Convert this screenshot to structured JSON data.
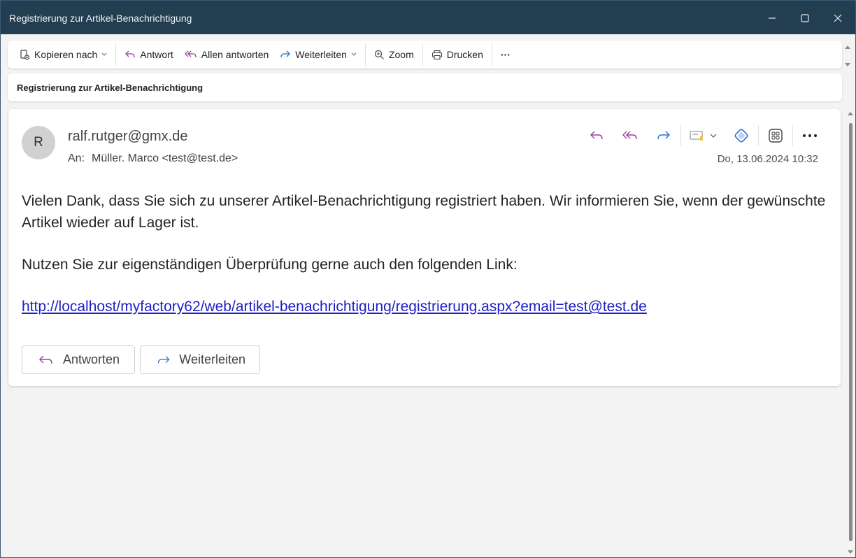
{
  "window": {
    "title": "Registrierung zur Artikel-Benachrichtigung"
  },
  "toolbar": {
    "copy_to": "Kopieren nach",
    "reply": "Antwort",
    "reply_all": "Allen antworten",
    "forward": "Weiterleiten",
    "zoom": "Zoom",
    "print": "Drucken",
    "more": "···"
  },
  "subject": "Registrierung zur Artikel-Benachrichtigung",
  "message": {
    "avatar_initial": "R",
    "sender": "ralf.rutger@gmx.de",
    "to_label": "An:",
    "to_value": "Müller. Marco <test@test.de>",
    "date": "Do, 13.06.2024 10:32",
    "body_p1": "Vielen Dank, dass Sie sich zu unserer Artikel-Benachrichtigung registriert haben. Wir informieren Sie, wenn der gewünschte Artikel wieder auf Lager ist.",
    "body_p2": "Nutzen Sie zur eigenständigen Überprüfung gerne auch den folgenden Link:",
    "link": "http://localhost/myfactory62/web/artikel-benachrichtigung/registrierung.aspx?email=test@test.de"
  },
  "reply_buttons": {
    "reply": "Antworten",
    "forward": "Weiterleiten"
  },
  "colors": {
    "titlebar": "#233d51",
    "reply_icon": "#9b3ea4",
    "forward_icon": "#2a6fdb",
    "link": "#2020c8"
  }
}
